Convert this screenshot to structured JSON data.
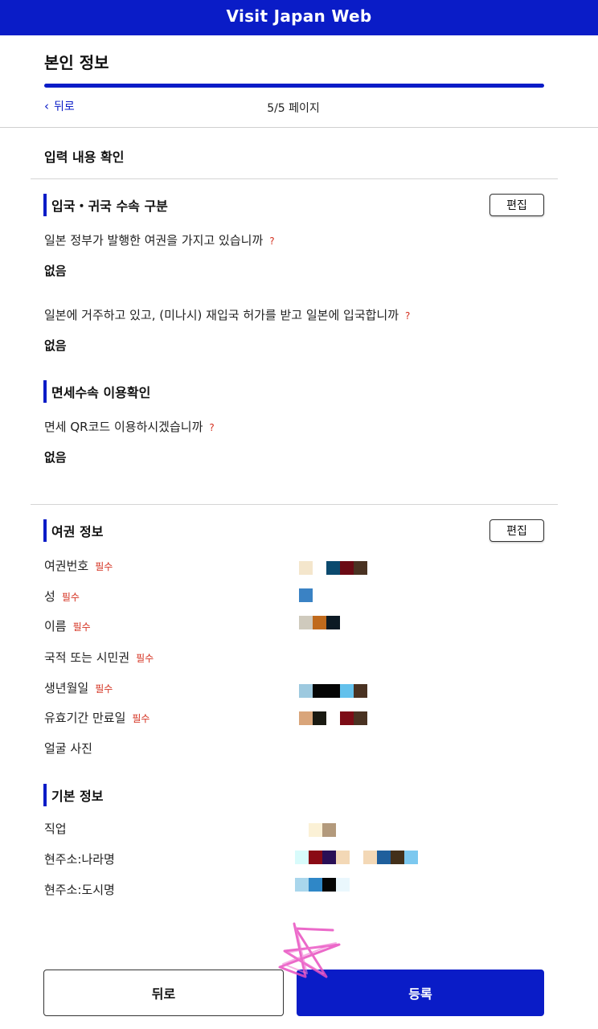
{
  "header": {
    "title": "Visit Japan Web"
  },
  "page": {
    "title": "본인 정보",
    "progress": 1.0,
    "back_label": "뒤로",
    "page_count": "5/5 페이지"
  },
  "confirm_heading": "입력 내용 확인",
  "sections": {
    "entry": {
      "title": "입국・귀국 수속 구분",
      "edit_label": "편집",
      "q1": "일본 정부가 발행한 여권을 가지고 있습니까",
      "a1": "없음",
      "q2": "일본에 거주하고 있고, (미나시) 재입국 허가를 받고 일본에 입국합니까",
      "a2": "없음",
      "help_mark": "?"
    },
    "taxfree": {
      "title": "면세수속 이용확인",
      "q1": "면세 QR코드 이용하시겠습니까",
      "a1": "없음",
      "help_mark": "?"
    },
    "passport": {
      "title": "여권 정보",
      "edit_label": "편집",
      "required_label": "필수",
      "rows": [
        {
          "label": "여권번호",
          "required": true
        },
        {
          "label": "성",
          "required": true
        },
        {
          "label": "이름",
          "required": true
        },
        {
          "label": "국적 또는 시민권",
          "required": true
        },
        {
          "label": "생년월일",
          "required": true
        },
        {
          "label": "유효기간 만료일",
          "required": true
        },
        {
          "label": "얼굴 사진",
          "required": false
        }
      ]
    },
    "basic": {
      "title": "기본 정보",
      "rows": [
        {
          "label": "직업"
        },
        {
          "label": "현주소:나라명"
        },
        {
          "label": "현주소:도시명"
        }
      ]
    }
  },
  "footer": {
    "back_button": "뒤로",
    "submit_button": "등록"
  },
  "colors": {
    "brand_blue": "#0a1cc7",
    "required_red": "#d4301f",
    "annotation_pink": "#e84fc0"
  }
}
